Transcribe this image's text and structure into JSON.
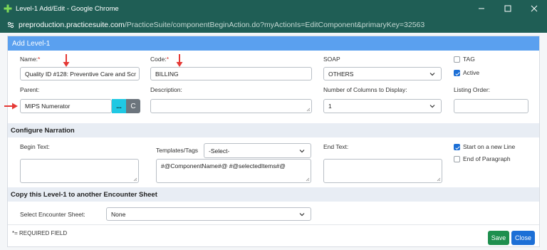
{
  "window": {
    "title": "Level-1  Add/Edit - Google Chrome",
    "url_host": "preproduction.practicesuite.com",
    "url_path": "/PracticeSuite/componentBeginAction.do?myActionIs=EditComponent&primaryKey=32563"
  },
  "form": {
    "header": "Add Level-1",
    "name_label": "Name:",
    "name_value": "Quality ID #128: Preventive Care and Scr",
    "code_label": "Code:",
    "code_value": "BILLING",
    "required_star": "*",
    "soap_label": "SOAP",
    "soap_value": "OTHERS",
    "tag_label": "TAG",
    "active_label": "Active",
    "parent_label": "Parent:",
    "parent_value": "MIPS Numerator",
    "parent_browse": "...",
    "parent_clear": "C",
    "description_label": "Description:",
    "columns_label": "Number of Columns to Display:",
    "columns_value": "1",
    "listing_label": "Listing Order:"
  },
  "narration": {
    "section_title": "Configure Narration",
    "begin_label": "Begin Text:",
    "templates_label": "Templates/Tags",
    "templates_value": "-Select-",
    "template_text": "#@ComponentName#@  #@selectedItems#@",
    "end_label": "End Text:",
    "new_line_label": "Start on a new Line",
    "end_paragraph_label": "End of Paragraph"
  },
  "copy": {
    "section_title": "Copy this Level-1 to another Encounter Sheet",
    "select_label": "Select Encounter Sheet:",
    "select_value": "None"
  },
  "footer": {
    "required_note": "*= REQUIRED FIELD",
    "save_label": "Save",
    "close_label": "Close"
  },
  "colors": {
    "titlebar": "#1f5e55",
    "header": "#5aa0ef",
    "browse": "#1fc8e3",
    "clear": "#6c757d",
    "save": "#1e8f4e",
    "close": "#1c6fd6",
    "annotation_arrow": "#e53935"
  }
}
